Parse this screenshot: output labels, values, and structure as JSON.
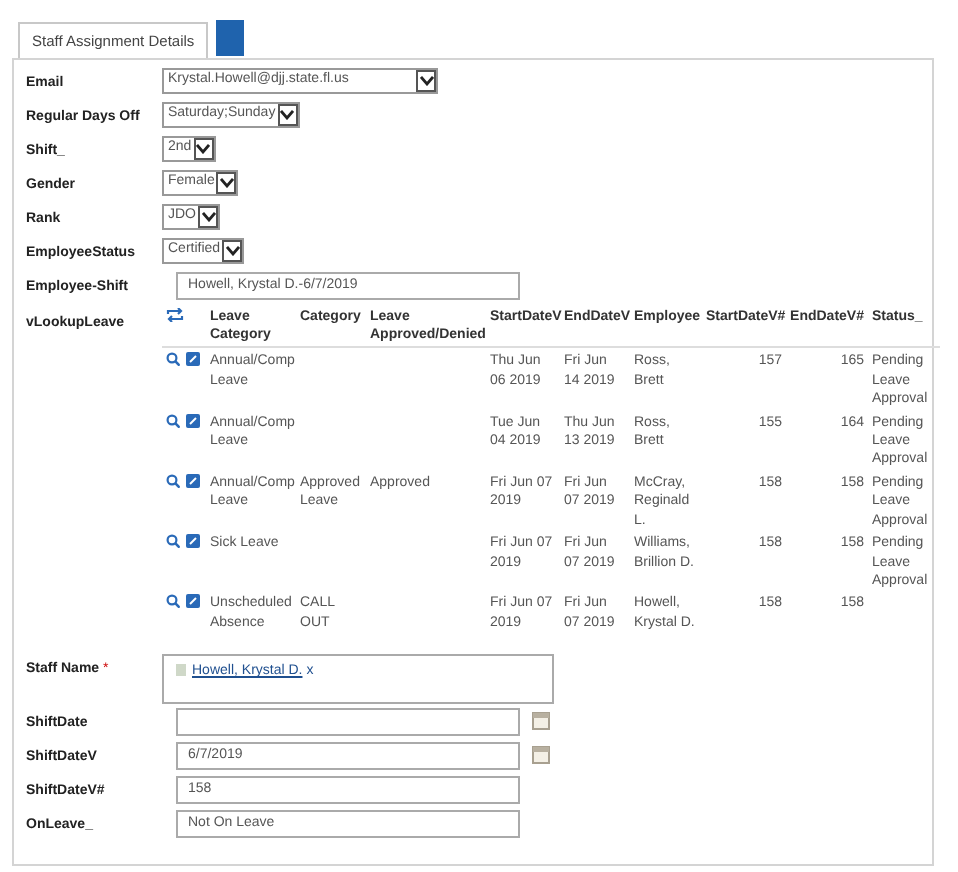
{
  "tabs": [
    {
      "label": "Staff Assignment Details",
      "selected": true
    }
  ],
  "fields": [
    {
      "kind": "select",
      "label": "Email",
      "value": "Krystal.Howell@djj.state.fl.us",
      "wide": true
    },
    {
      "kind": "select",
      "label": "Regular Days Off",
      "value": "Saturday;Sunday"
    },
    {
      "kind": "select",
      "label": "Shift_",
      "value": "2nd"
    },
    {
      "kind": "select",
      "label": "Gender",
      "value": "Female"
    },
    {
      "kind": "select",
      "label": "Rank",
      "value": "JDO"
    },
    {
      "kind": "select",
      "label": "EmployeeStatus",
      "value": "Certified"
    },
    {
      "kind": "text",
      "label": "Employee-Shift",
      "value": "Howell, Krystal D.-6/7/2019"
    },
    {
      "kind": "lookup",
      "label": "vLookupLeave",
      "columns": [
        {
          "title": "Leave Category"
        },
        {
          "title": "Category"
        },
        {
          "title": "Leave Approved/Denied"
        },
        {
          "title": "StartDateV"
        },
        {
          "title": "EndDateV"
        },
        {
          "title": "Employee"
        },
        {
          "title": "StartDateV#",
          "numeric": true
        },
        {
          "title": "EndDateV#",
          "numeric": true
        },
        {
          "title": "Status_"
        }
      ],
      "rows": [
        [
          "Annual/Comp Leave",
          "",
          "",
          "Thu Jun 06 2019",
          "Fri Jun 14 2019",
          "Ross, Brett",
          "157",
          "165",
          "Pending Leave Approval"
        ],
        [
          "Annual/Comp Leave",
          "",
          "",
          "Tue Jun 04 2019",
          "Thu Jun 13 2019",
          "Ross, Brett",
          "155",
          "164",
          "Pending Leave Approval"
        ],
        [
          "Annual/Comp Leave",
          "Approved Leave",
          "Approved",
          "Fri Jun 07 2019",
          "Fri Jun 07 2019",
          "McCray, Reginald L.",
          "158",
          "158",
          "Pending Leave Approval"
        ],
        [
          "Sick Leave",
          "",
          "",
          "Fri Jun 07 2019",
          "Fri Jun 07 2019",
          "Williams, Brillion D.",
          "158",
          "158",
          "Pending Leave Approval"
        ],
        [
          "Unscheduled Absence",
          "CALL OUT",
          "",
          "Fri Jun 07 2019",
          "Fri Jun 07 2019",
          "Howell, Krystal D.",
          "158",
          "158",
          ""
        ]
      ]
    },
    {
      "kind": "people",
      "label": "Staff Name",
      "required_mark": "*",
      "value": "Howell, Krystal D.",
      "remove": "x"
    },
    {
      "kind": "date",
      "label": "ShiftDate"
    },
    {
      "kind": "date",
      "label": "ShiftDateV",
      "value": "6/7/2019"
    },
    {
      "kind": "text",
      "label": "ShiftDateV#",
      "value": "158"
    },
    {
      "kind": "text",
      "label": "OnLeave_",
      "value": "Not On Leave"
    }
  ]
}
